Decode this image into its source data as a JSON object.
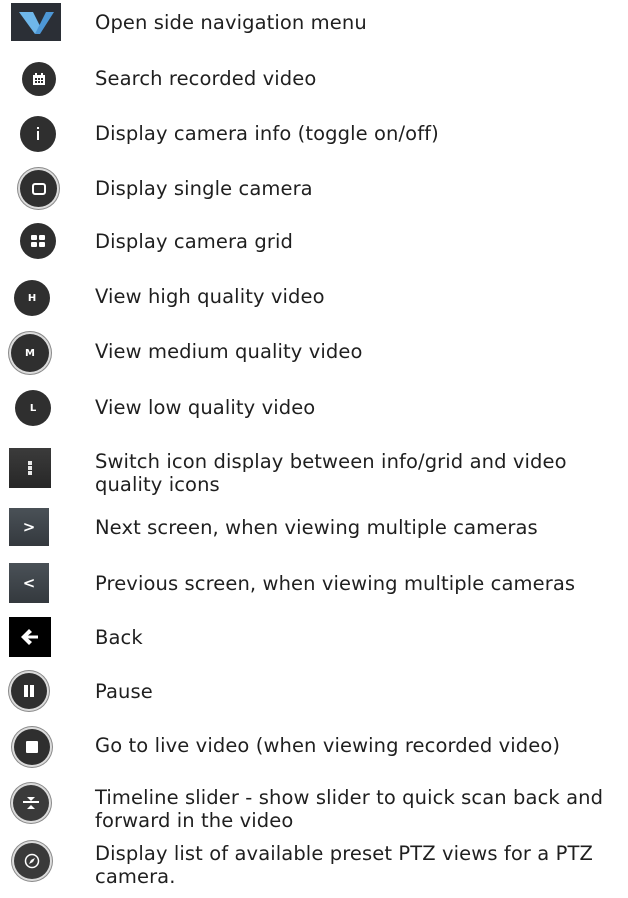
{
  "legend_items": [
    {
      "icon": "side-menu-icon",
      "label": "Open side navigation menu"
    },
    {
      "icon": "calendar-icon",
      "label": "Search recorded video"
    },
    {
      "icon": "info-icon",
      "label": "Display camera info (toggle on/off)"
    },
    {
      "icon": "single-camera-icon",
      "label": "Display single camera"
    },
    {
      "icon": "camera-grid-icon",
      "label": "Display camera grid"
    },
    {
      "icon": "high-quality-icon",
      "glyph": "H",
      "label": "View high quality video"
    },
    {
      "icon": "medium-quality-icon",
      "glyph": "M",
      "label": "View medium quality video"
    },
    {
      "icon": "low-quality-icon",
      "glyph": "L",
      "label": "View low quality video"
    },
    {
      "icon": "switch-icons-icon",
      "label": "Switch icon display between info/grid and video quality icons"
    },
    {
      "icon": "next-screen-icon",
      "glyph": ">",
      "label": "Next screen, when viewing multiple cameras"
    },
    {
      "icon": "previous-screen-icon",
      "glyph": "<",
      "label": "Previous screen, when viewing multiple cameras"
    },
    {
      "icon": "back-arrow-icon",
      "label": "Back"
    },
    {
      "icon": "pause-icon",
      "label": "Pause"
    },
    {
      "icon": "live-video-icon",
      "label": "Go to live video (when viewing recorded video)"
    },
    {
      "icon": "timeline-slider-icon",
      "label": "Timeline slider - show slider to quick scan back and forward in the video"
    },
    {
      "icon": "ptz-presets-icon",
      "label": "Display list of available preset PTZ views for a PTZ camera."
    }
  ],
  "colors": {
    "icon_dark": "#2f2f2f",
    "menu_accent": "#5aa9e6",
    "text": "#1f1f1f"
  }
}
